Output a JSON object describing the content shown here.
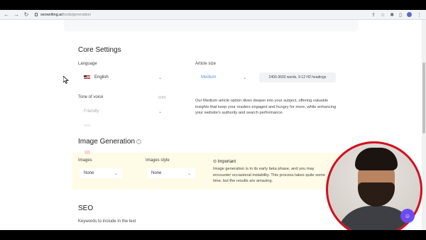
{
  "browser": {
    "url_host": "seowriting.ai",
    "url_path": "/tools/generation",
    "nav_back": "←",
    "nav_forward": "→",
    "nav_reload": "↻"
  },
  "core_settings": {
    "title": "Core Settings",
    "language": {
      "label": "Language",
      "value": "English"
    },
    "article_size": {
      "label": "Article size",
      "value": "Medium",
      "summary": "2400-3600 words, 9-12 H2 headings",
      "description": "Our Medium article option dives deeper into your subject, offering valuable insights that keep your readers engaged and hungry for more, while enhancing your website's authority and search performance."
    },
    "tone_of_voice": {
      "label": "Tone of voice",
      "value": "Friendly",
      "counter": "0/50"
    }
  },
  "image_generation": {
    "title": "Image Generation",
    "images": {
      "label": "Images",
      "value": "None"
    },
    "images_style": {
      "label": "Images style",
      "value": "None"
    },
    "notice": {
      "title": "Important",
      "text": "Image generation is in its early beta phase, and you may encounter occasional instability. This process takes quite some time, but the results are amazing."
    }
  },
  "seo": {
    "title": "SEO",
    "keywords_label": "Keywords to include in the text"
  },
  "icons": [
    "back-icon",
    "forward-icon",
    "reload-icon",
    "lock-icon",
    "chevron-down-icon",
    "info-icon",
    "important-icon",
    "chat-icon"
  ],
  "colors": {
    "accent": "#6c4cf0",
    "link_blue": "#5a8fd8",
    "notice_bg": "#fefbe7",
    "webcam_border": "#d01020"
  }
}
